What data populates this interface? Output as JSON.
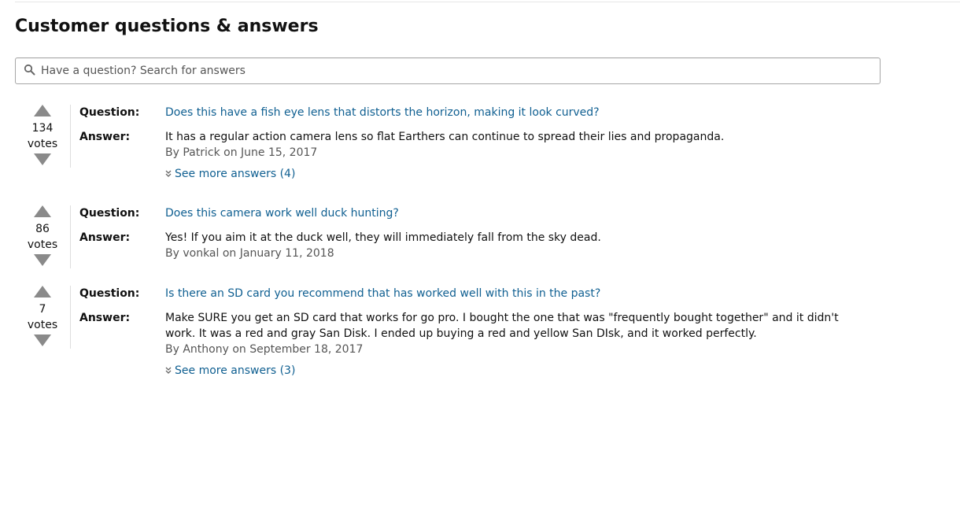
{
  "page": {
    "heading": "Customer questions & answers",
    "search": {
      "placeholder": "Have a question? Search for answers",
      "icon": "search-icon"
    },
    "labels": {
      "question": "Question:",
      "answer": "Answer:",
      "votes": "votes"
    },
    "colors": {
      "link": "#0f5f91",
      "vote_arrow": "#8a8a8a",
      "byline": "#555555"
    }
  },
  "qa": [
    {
      "votes": "134",
      "question": "Does this have a fish eye lens that distorts the horizon, making it look curved?",
      "answer": "It has a regular action camera lens so flat Earthers can continue to spread their lies and propaganda.",
      "byline": "By Patrick on June 15, 2017",
      "see_more": "See more answers (4)"
    },
    {
      "votes": "86",
      "question": "Does this camera work well duck hunting?",
      "answer": "Yes! If you aim it at the duck well, they will immediately fall from the sky dead.",
      "byline": "By vonkal on January 11, 2018",
      "see_more": ""
    },
    {
      "votes": "7",
      "question": "Is there an SD card you recommend that has worked well with this in the past?",
      "answer": "Make SURE you get an SD card that works for go pro. I bought the one that was \"frequently bought together\" and it didn't work. It was a red and gray San Disk. I ended up buying a red and yellow San DIsk, and it worked perfectly.",
      "byline": "By Anthony on September 18, 2017",
      "see_more": "See more answers (3)"
    }
  ]
}
